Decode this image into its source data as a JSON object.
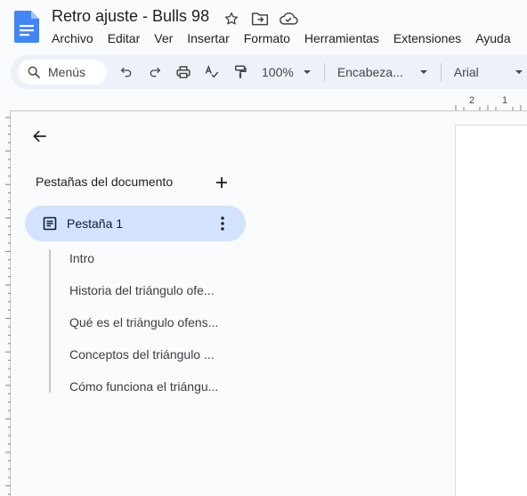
{
  "document": {
    "title": "Retro ajuste - Bulls 98"
  },
  "menu": {
    "items": [
      "Archivo",
      "Editar",
      "Ver",
      "Insertar",
      "Formato",
      "Herramientas",
      "Extensiones",
      "Ayuda"
    ]
  },
  "toolbar": {
    "search_label": "Menús",
    "zoom": "100%",
    "style": "Encabeza...",
    "font": "Arial"
  },
  "ruler": {
    "h_labels": [
      "2",
      "1"
    ]
  },
  "panel": {
    "heading": "Pestañas del documento",
    "tab": {
      "label": "Pestaña 1"
    },
    "outline": [
      "Intro",
      "Historia del triángulo ofe...",
      "Qué es el triángulo ofens...",
      "Conceptos del triángulo ...",
      "Cómo funciona el triángu..."
    ]
  },
  "colors": {
    "doc_blue": "#4285f4",
    "selected_tab_bg": "#d3e3fd",
    "toolbar_bg": "#edf2fa"
  }
}
